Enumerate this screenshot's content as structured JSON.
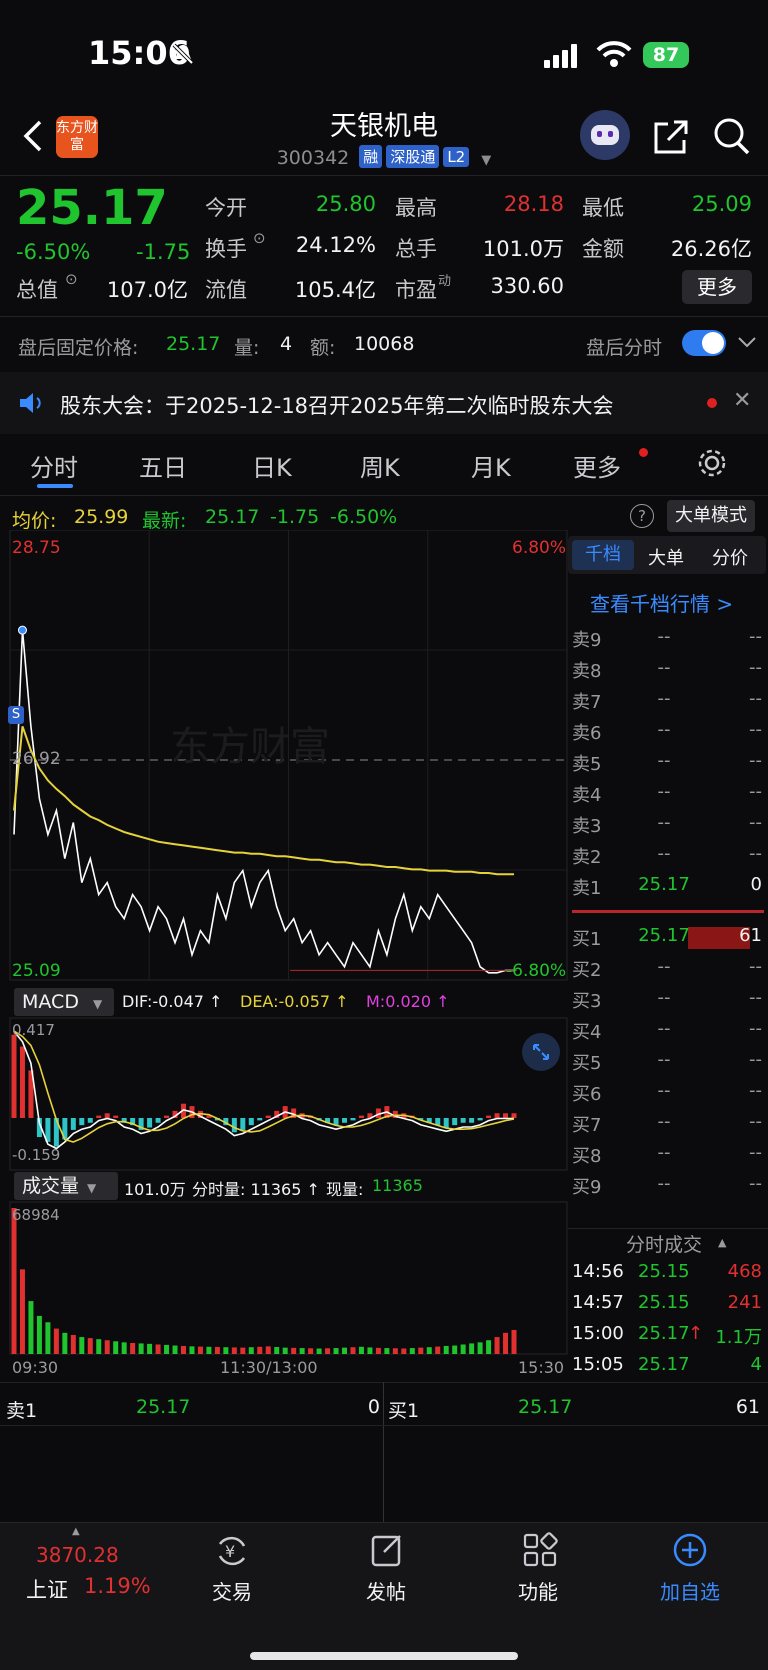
{
  "status_bar": {
    "time": "15:06",
    "battery": "87"
  },
  "header": {
    "title": "天银机电",
    "code": "300342",
    "tags": [
      "融",
      "深股通",
      "L2"
    ],
    "logo_text": "东方财富"
  },
  "quote": {
    "price": "25.17",
    "change_pct": "-6.50%",
    "change": "-1.75",
    "fields": [
      {
        "k": "今开",
        "v": "25.80",
        "c": "green"
      },
      {
        "k": "最高",
        "v": "28.18",
        "c": "red"
      },
      {
        "k": "最低",
        "v": "25.09",
        "c": "green"
      },
      {
        "k": "换手",
        "v": "24.12%",
        "c": "white"
      },
      {
        "k": "总手",
        "v": "101.0万",
        "c": "white"
      },
      {
        "k": "金额",
        "v": "26.26亿",
        "c": "white"
      },
      {
        "k": "总值",
        "v": "107.0亿",
        "c": "white"
      },
      {
        "k": "流值",
        "v": "105.4亿",
        "c": "white"
      },
      {
        "k": "市盈",
        "v": "330.60",
        "c": "white"
      }
    ],
    "pe_sup": "动",
    "more_button": "更多"
  },
  "after_hours": {
    "label": "盘后固定价格:",
    "price": "25.17",
    "vol_label": "量:",
    "vol": "4",
    "amt_label": "额:",
    "amt": "10068",
    "toggle_label": "盘后分时",
    "toggle_on": true
  },
  "notice": {
    "text": "股东大会：于2025-12-18召开2025年第二次临时股东大会"
  },
  "tabs": [
    "分时",
    "五日",
    "日K",
    "周K",
    "月K",
    "更多"
  ],
  "active_tab": 0,
  "info_line": {
    "avg_label": "均价:",
    "avg": "25.99",
    "latest_label": "最新:",
    "latest": "25.17",
    "change": "-1.75",
    "pct": "-6.50%",
    "big_order_button": "大单模式"
  },
  "chart_data": {
    "type": "line",
    "y_top_label": "28.75",
    "y_mid_label": "26.92",
    "y_bottom_label": "25.09",
    "pct_top_label": "6.80%",
    "pct_bottom_label": "-6.80%",
    "ylim": [
      25.09,
      28.75
    ],
    "x_labels": [
      "09:30",
      "11:30/13:00",
      "15:30"
    ],
    "watermark": "东方财富",
    "series": [
      {
        "name": "最新",
        "color": "#ffffff",
        "values": [
          26.3,
          28.0,
          27.2,
          26.6,
          26.3,
          26.5,
          26.1,
          26.4,
          25.9,
          26.1,
          25.8,
          25.9,
          25.7,
          25.6,
          25.8,
          25.7,
          25.5,
          25.7,
          25.6,
          25.4,
          25.6,
          25.3,
          25.5,
          25.4,
          25.8,
          25.6,
          25.9,
          26.0,
          25.7,
          25.9,
          26.0,
          25.7,
          25.5,
          25.6,
          25.4,
          25.5,
          25.3,
          25.4,
          25.3,
          25.2,
          25.4,
          25.3,
          25.2,
          25.5,
          25.3,
          25.6,
          25.8,
          25.5,
          25.7,
          25.6,
          25.8,
          25.7,
          25.6,
          25.5,
          25.4,
          25.2,
          25.15,
          25.15,
          25.17,
          25.17
        ]
      },
      {
        "name": "均价",
        "color": "#e6d23a",
        "values": [
          26.5,
          27.2,
          27.0,
          26.85,
          26.75,
          26.68,
          26.62,
          26.55,
          26.5,
          26.45,
          26.42,
          26.38,
          26.35,
          26.32,
          26.3,
          26.28,
          26.26,
          26.24,
          26.23,
          26.22,
          26.21,
          26.2,
          26.19,
          26.18,
          26.17,
          26.16,
          26.15,
          26.15,
          26.14,
          26.14,
          26.13,
          26.12,
          26.12,
          26.11,
          26.1,
          26.09,
          26.09,
          26.08,
          26.07,
          26.07,
          26.06,
          26.05,
          26.05,
          26.04,
          26.03,
          26.03,
          26.02,
          26.01,
          26.01,
          26.0,
          26.0,
          26.0,
          25.99,
          25.99,
          25.99,
          25.98,
          25.98,
          25.97,
          25.97,
          25.97
        ]
      }
    ],
    "macd": {
      "label": "MACD",
      "dif_label": "DIF:",
      "dif": "-0.047",
      "dea_label": "DEA:",
      "dea": "-0.057",
      "m_label": "M:",
      "m": "0.020",
      "top": "0.417",
      "bottom": "-0.159",
      "hist": [
        0.35,
        0.3,
        0.2,
        -0.08,
        -0.1,
        -0.12,
        -0.09,
        -0.05,
        -0.03,
        -0.02,
        0.01,
        0.02,
        0.01,
        -0.02,
        -0.03,
        -0.05,
        -0.04,
        -0.02,
        0.01,
        0.03,
        0.06,
        0.05,
        0.03,
        0.01,
        -0.01,
        -0.03,
        -0.06,
        -0.05,
        -0.03,
        -0.01,
        0.01,
        0.03,
        0.05,
        0.04,
        0.02,
        0.01,
        -0.01,
        -0.02,
        -0.03,
        -0.02,
        -0.01,
        0.01,
        0.02,
        0.04,
        0.05,
        0.03,
        0.02,
        0.01,
        -0.01,
        -0.02,
        -0.03,
        -0.04,
        -0.03,
        -0.02,
        -0.02,
        -0.01,
        0.01,
        0.02,
        0.02,
        0.02
      ]
    },
    "volume": {
      "label": "成交量",
      "total": "101.0万",
      "period_label": "分时量:",
      "period": "11365",
      "now_label": "现量:",
      "now": "11365",
      "top": "68984",
      "values": [
        68984,
        40000,
        25000,
        18000,
        15000,
        12000,
        10000,
        9000,
        8000,
        7500,
        7000,
        6500,
        6000,
        5500,
        5200,
        5000,
        4800,
        4500,
        4300,
        4000,
        3800,
        3600,
        3500,
        3400,
        3300,
        3200,
        3100,
        3000,
        3200,
        3400,
        3600,
        3300,
        3000,
        2900,
        2800,
        2700,
        2600,
        2700,
        2800,
        3000,
        3200,
        3400,
        3100,
        2900,
        2800,
        2700,
        2600,
        2800,
        3000,
        3200,
        3500,
        3800,
        4000,
        4500,
        5000,
        5500,
        6500,
        8000,
        10000,
        11365
      ]
    }
  },
  "side_panel": {
    "tabs": [
      "千档",
      "大单",
      "分价"
    ],
    "link": "查看千档行情 >",
    "asks": [
      {
        "k": "卖9",
        "p": "--",
        "v": "--"
      },
      {
        "k": "卖8",
        "p": "--",
        "v": "--"
      },
      {
        "k": "卖7",
        "p": "--",
        "v": "--"
      },
      {
        "k": "卖6",
        "p": "--",
        "v": "--"
      },
      {
        "k": "卖5",
        "p": "--",
        "v": "--"
      },
      {
        "k": "卖4",
        "p": "--",
        "v": "--"
      },
      {
        "k": "卖3",
        "p": "--",
        "v": "--"
      },
      {
        "k": "卖2",
        "p": "--",
        "v": "--"
      },
      {
        "k": "卖1",
        "p": "25.17",
        "v": "0"
      }
    ],
    "bids": [
      {
        "k": "买1",
        "p": "25.17",
        "v": "61"
      },
      {
        "k": "买2",
        "p": "--",
        "v": "--"
      },
      {
        "k": "买3",
        "p": "--",
        "v": "--"
      },
      {
        "k": "买4",
        "p": "--",
        "v": "--"
      },
      {
        "k": "买5",
        "p": "--",
        "v": "--"
      },
      {
        "k": "买6",
        "p": "--",
        "v": "--"
      },
      {
        "k": "买7",
        "p": "--",
        "v": "--"
      },
      {
        "k": "买8",
        "p": "--",
        "v": "--"
      },
      {
        "k": "买9",
        "p": "--",
        "v": "--"
      }
    ],
    "trades_title": "分时成交",
    "trades": [
      {
        "t": "14:56",
        "p": "25.15",
        "v": "468",
        "vc": "red",
        "arrow": ""
      },
      {
        "t": "14:57",
        "p": "25.15",
        "v": "241",
        "vc": "red",
        "arrow": ""
      },
      {
        "t": "15:00",
        "p": "25.17",
        "v": "1.1万",
        "vc": "green",
        "arrow": "↑"
      },
      {
        "t": "15:05",
        "p": "25.17",
        "v": "4",
        "vc": "green",
        "arrow": ""
      }
    ]
  },
  "bottom_quote": {
    "ask_label": "卖1",
    "ask_price": "25.17",
    "ask_vol": "0",
    "bid_label": "买1",
    "bid_price": "25.17",
    "bid_vol": "61"
  },
  "bottom_nav": {
    "index_value": "3870.28",
    "index_name": "上证",
    "index_pct": "1.19%",
    "items": [
      "交易",
      "发帖",
      "功能",
      "加自选"
    ]
  }
}
